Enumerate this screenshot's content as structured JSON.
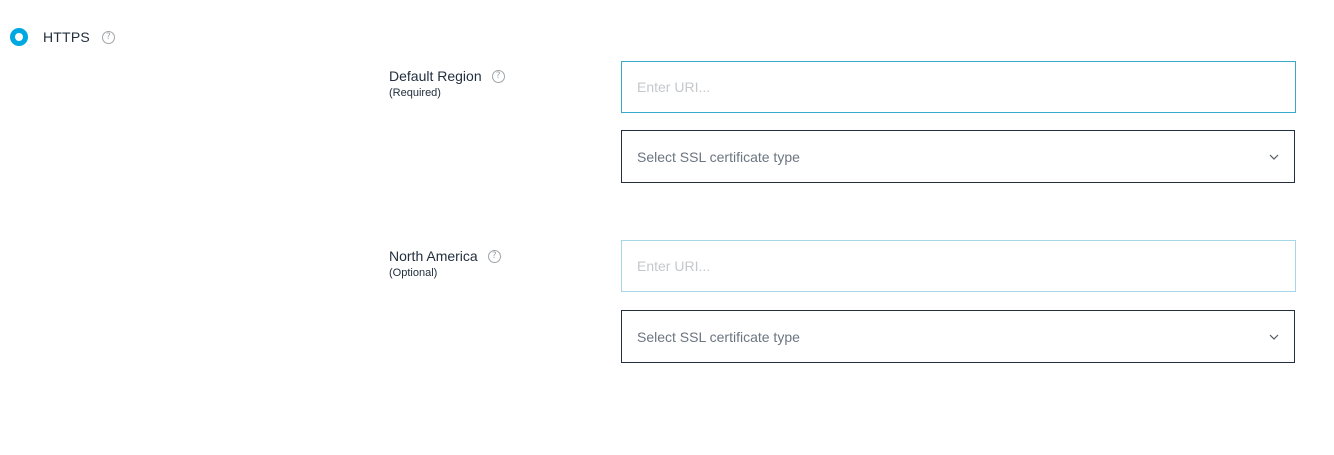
{
  "protocol": {
    "label": "HTTPS",
    "help_glyph": "?",
    "selected": true,
    "accent_color": "#00a8e1"
  },
  "regions": [
    {
      "name": "Default Region",
      "requirement": "(Required)",
      "help_glyph": "?",
      "uri_placeholder": "Enter URI...",
      "uri_value": "",
      "ssl_select_text": "Select SSL certificate type",
      "chevron_icon": "chevron-down-icon"
    },
    {
      "name": "North America",
      "requirement": "(Optional)",
      "help_glyph": "?",
      "uri_placeholder": "Enter URI...",
      "uri_value": "",
      "ssl_select_text": "Select SSL certificate type",
      "chevron_icon": "chevron-down-icon"
    }
  ]
}
